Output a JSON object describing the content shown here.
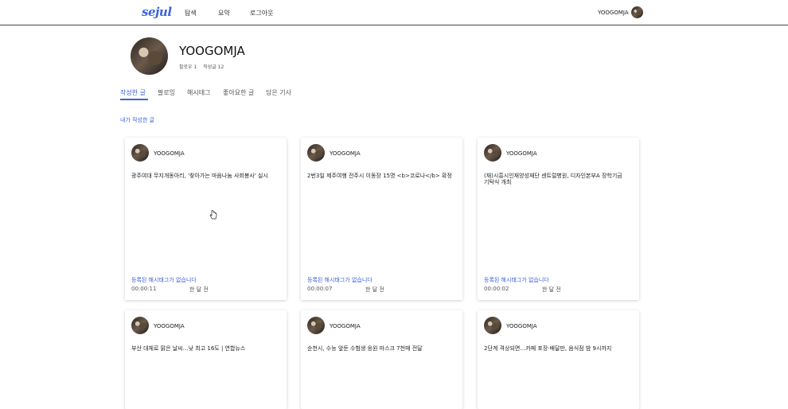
{
  "header": {
    "logo": "sejul",
    "nav": [
      "탐색",
      "요약",
      "로그아웃"
    ],
    "username": "YOOGOMJA"
  },
  "profile": {
    "name": "YOOGOMJA",
    "followers": "팔로우 1",
    "posts": "작성글 12"
  },
  "tabs": [
    "작성한 글",
    "팔로잉",
    "해시태그",
    "좋아요한 글",
    "담은 기사"
  ],
  "section_label": "내가 작성한 글",
  "cards": [
    {
      "user": "YOOGOMJA",
      "title": "광주여대 무지개동아리, '찾아가는 마음나눔 사회봉사' 실시",
      "hashtag": "등록된 해시태그가 없습니다",
      "duration": "00:00:11",
      "ago": "한 달 전"
    },
    {
      "user": "YOOGOMJA",
      "title": "2번3일 제주여행 전주시 이동장 15명 <b>코로나</b> 확정",
      "hashtag": "등록된 해시태그가 없습니다",
      "duration": "00:00:07",
      "ago": "한 달 전"
    },
    {
      "user": "YOOGOMJA",
      "title": "(재)시흥시인재양성재단 센트럴병원, 디자인본부A 장학기금 기탁식 개최",
      "hashtag": "등록된 해시태그가 없습니다",
      "duration": "00:00:02",
      "ago": "한 달 전"
    },
    {
      "user": "YOOGOMJA",
      "title": "부산 대체로 맑은 날씨…낮 최고 16도 | 연합뉴스",
      "hashtag": "",
      "duration": "",
      "ago": ""
    },
    {
      "user": "YOOGOMJA",
      "title": "순천시, 수능 앞둔 수험생 응원 마스크 7천매 전달",
      "hashtag": "",
      "duration": "",
      "ago": ""
    },
    {
      "user": "YOOGOMJA",
      "title": "2단계 격상되면…카페 포장·배달만, 음식점 밤 9시까지",
      "hashtag": "",
      "duration": "",
      "ago": ""
    }
  ],
  "colors": {
    "accent": "#3b64d8",
    "header_border": "#444444"
  },
  "icons": {
    "cursor": "hand-pointer-icon"
  }
}
